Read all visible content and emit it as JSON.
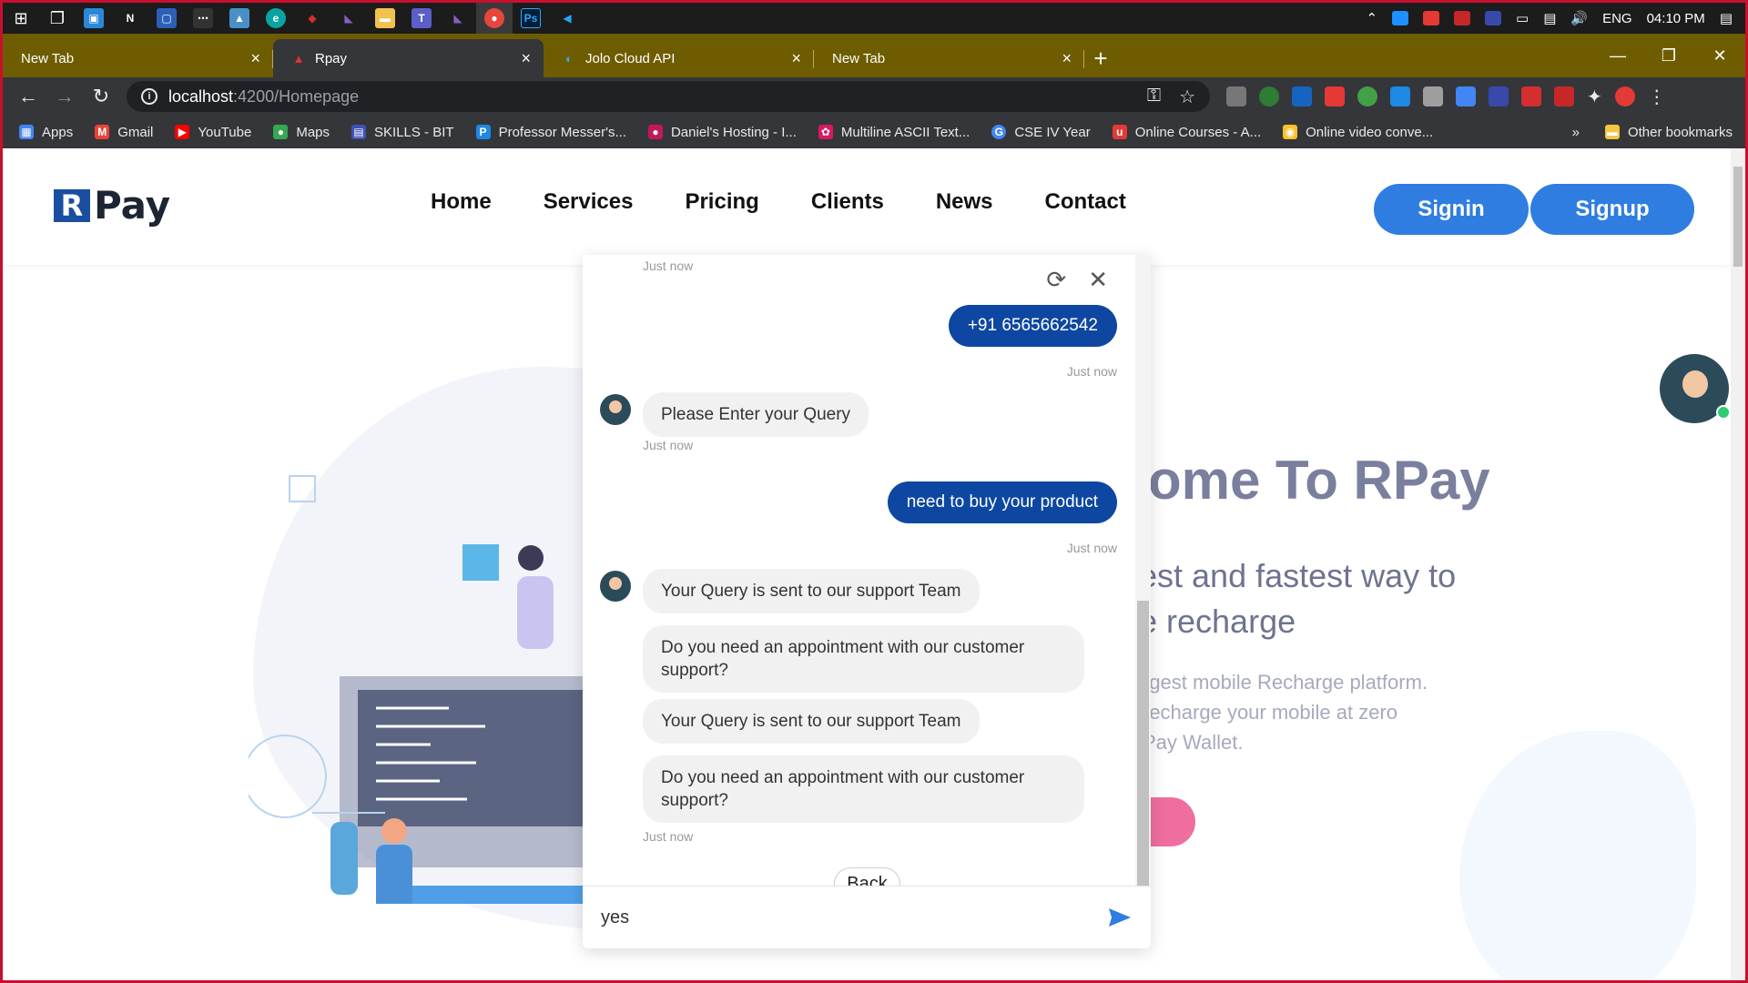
{
  "taskbar": {
    "language": "ENG",
    "time": "04:10 PM"
  },
  "tabs": [
    {
      "label": "New Tab",
      "active": false
    },
    {
      "label": "Rpay",
      "active": true
    },
    {
      "label": "Jolo Cloud API",
      "active": false
    },
    {
      "label": "New Tab",
      "active": false
    }
  ],
  "address": {
    "host": "localhost",
    "path": ":4200/Homepage"
  },
  "bookmarks": {
    "items": [
      {
        "label": "Apps",
        "color": "#4285f4"
      },
      {
        "label": "Gmail",
        "color": "#ea4335"
      },
      {
        "label": "YouTube",
        "color": "#ff0000"
      },
      {
        "label": "Maps",
        "color": "#34a853"
      },
      {
        "label": "SKILLS - BIT",
        "color": "#3f51b5"
      },
      {
        "label": "Professor Messer's...",
        "color": "#1e88e5"
      },
      {
        "label": "Daniel's Hosting - I...",
        "color": "#c2185b"
      },
      {
        "label": "Multiline ASCII Text...",
        "color": "#d81b60"
      },
      {
        "label": "CSE IV Year",
        "color": "#4285f4"
      },
      {
        "label": "Online Courses - A...",
        "color": "#e53935"
      },
      {
        "label": "Online video conve...",
        "color": "#fbc02d"
      }
    ],
    "more": "»",
    "other": "Other bookmarks"
  },
  "site": {
    "logo_text": "Pay",
    "nav": [
      "Home",
      "Services",
      "Pricing",
      "Clients",
      "News",
      "Contact"
    ],
    "signin": "Signin",
    "signup": "Signup"
  },
  "hero": {
    "title": "ome To RPay",
    "subtitle_line1": "est and fastest way to",
    "subtitle_line2": "e recharge",
    "text_line1": "rgest mobile Recharge platform.",
    "text_line2": "recharge your mobile at zero",
    "text_line3": "Pay Wallet."
  },
  "chat": {
    "top_timestamp": "Just now",
    "phone_message": "+91 6565662542",
    "phone_timestamp": "Just now",
    "query_prompt": "Please Enter your Query",
    "query_prompt_timestamp": "Just now",
    "user_query": "need to buy your product",
    "user_query_timestamp": "Just now",
    "reply1": "Your Query is sent to our support Team",
    "reply2": "Do you need an appointment with our customer support?",
    "reply3": "Your Query is sent to our support Team",
    "reply4": "Do you need an appointment with our customer support?",
    "reply_timestamp": "Just now",
    "back_label": "Back",
    "input_value": "yes"
  }
}
